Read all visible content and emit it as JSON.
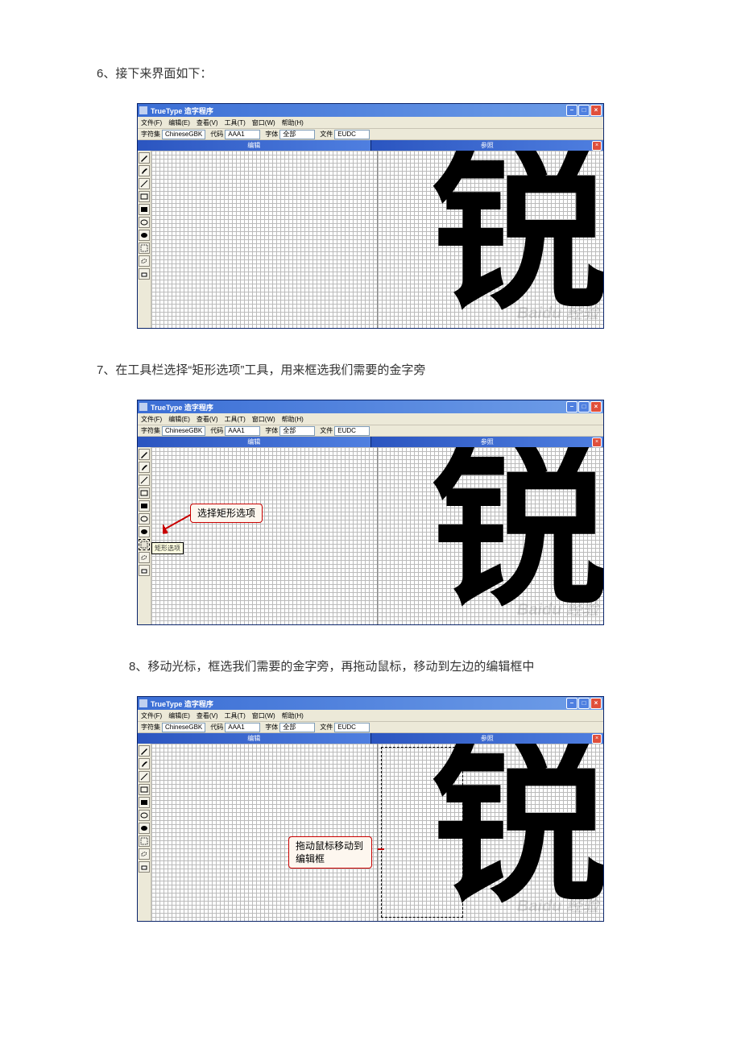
{
  "steps": [
    {
      "num": "6",
      "text": "接下来界面如下："
    },
    {
      "num": "7",
      "text": "在工具栏选择“矩形选项”工具，用来框选我们需要的金字旁"
    },
    {
      "num": "8",
      "text": "移动光标，框选我们需要的金字旁，再拖动鼠标，移动到左边的编辑框中"
    }
  ],
  "window": {
    "title": "TrueType 造字程序",
    "menus": [
      "文件(F)",
      "编辑(E)",
      "查看(V)",
      "工具(T)",
      "窗口(W)",
      "帮助(H)"
    ],
    "options": {
      "charset_label": "字符集",
      "charset_value": "ChineseGBK",
      "code_label": "代码",
      "code_value": "AAA1",
      "font_label": "字体",
      "font_value": "全部",
      "file_label": "文件",
      "file_value": "EUDC"
    },
    "panel_left_title": "编辑",
    "panel_right_title": "参照",
    "glyph": "锐",
    "tools": [
      "pencil-icon",
      "brush-icon",
      "line-icon",
      "rect-outline-icon",
      "rect-fill-icon",
      "ellipse-outline-icon",
      "ellipse-fill-icon",
      "rect-select-icon",
      "free-select-icon",
      "eraser-icon"
    ],
    "rect_select_tooltip": "矩形选项"
  },
  "callouts": {
    "step7": "选择矩形选项",
    "step8": "拖动鼠标移动到编辑框"
  },
  "watermark": "Baidu 经验"
}
